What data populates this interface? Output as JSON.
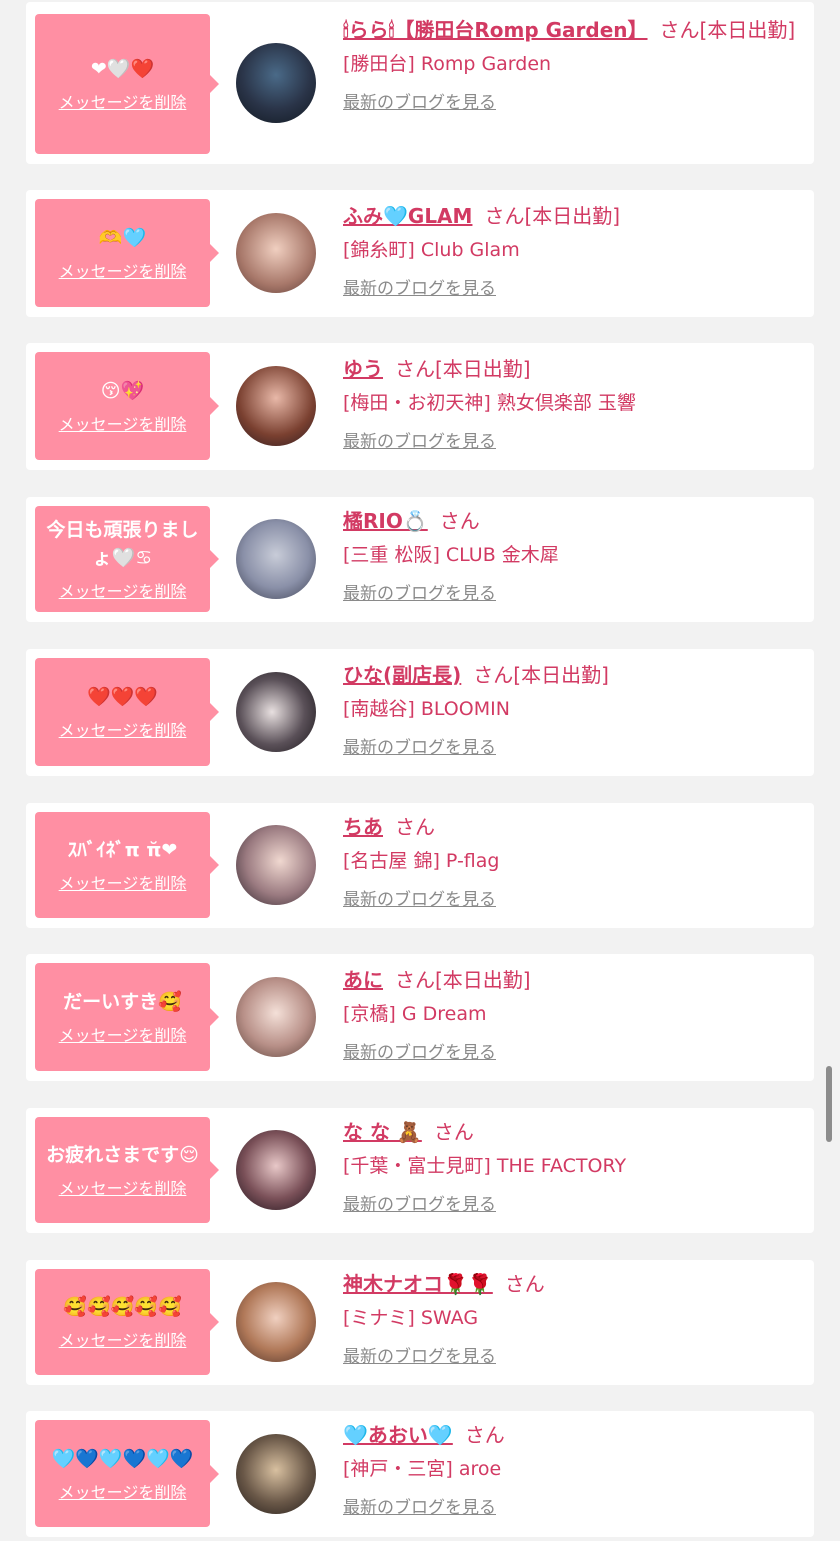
{
  "delete_label": "メッセージを削除",
  "blog_label": "最新のブログを見る",
  "san": "さん",
  "colors": {
    "background": "#f2f2f2",
    "bubble": "#ff8fa3",
    "name": "#d23a63",
    "link_gray": "#8a8a8a"
  },
  "items": [
    {
      "message": "❤🤍❤️",
      "name": "🕯らら🕯【勝田台Romp Garden】",
      "status": "[本日出勤]",
      "shop": "[勝田台] Romp Garden"
    },
    {
      "message": "🫶🩵",
      "name": "ふみ🩵GLAM",
      "status": "[本日出勤]",
      "shop": "[錦糸町] Club Glam"
    },
    {
      "message": "😚💖",
      "name": "ゆう",
      "status": "[本日出勤]",
      "shop": "[梅田・お初天神] 熟女倶楽部 玉響"
    },
    {
      "message": "今日も頑張りましょ🤍♋︎",
      "name": "橘RIO💍",
      "status": "",
      "shop": "[三重 松阪] CLUB 金木犀"
    },
    {
      "message": "❤️❤️❤️",
      "name": "ひな(副店長)",
      "status": "[本日出勤]",
      "shop": "[南越谷] BLOOMIN"
    },
    {
      "message": "ｽﾊﾞｲﾈﾞπ π̆❤",
      "name": "ちあ",
      "status": "",
      "shop": "[名古屋 錦] P-flag"
    },
    {
      "message": "だーいすき🥰",
      "name": "あに",
      "status": "[本日出勤]",
      "shop": "[京橋] G Dream"
    },
    {
      "message": "お疲れさまです😌",
      "name": "な な 🧸",
      "status": "",
      "shop": "[千葉・富士見町] THE FACTORY"
    },
    {
      "message": "🥰🥰🥰🥰🥰",
      "name": "神木ナオコ🌹🌹",
      "status": "",
      "shop": "[ミナミ] SWAG"
    },
    {
      "message": "🩵💙🩵💙🩵💙",
      "name": "🩵あおい🩵",
      "status": "",
      "shop": "[神戸・三宮] aroe"
    }
  ]
}
